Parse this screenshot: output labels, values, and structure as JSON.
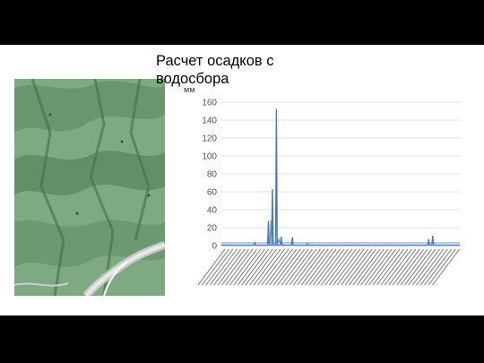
{
  "slide": {
    "title_line1": "Расчет осадков с",
    "title_line2": "водосбора"
  },
  "map": {
    "icon": "topographic-map-image"
  },
  "chart_data": {
    "type": "line",
    "title": "",
    "ylabel": "мм",
    "ylim": [
      0,
      160
    ],
    "yticks": [
      0,
      20,
      40,
      60,
      80,
      100,
      120,
      140,
      160
    ],
    "grid": true,
    "legend": "none",
    "color": "#4a7ab5",
    "points": 300,
    "baseline": 0.5,
    "series": [
      {
        "peaks": [
          {
            "x": 42,
            "y": 3
          },
          {
            "x": 59,
            "y": 27
          },
          {
            "x": 64,
            "y": 63
          },
          {
            "x": 69,
            "y": 152
          },
          {
            "x": 75,
            "y": 10
          },
          {
            "x": 89,
            "y": 9
          },
          {
            "x": 108,
            "y": 2
          },
          {
            "x": 260,
            "y": 7
          },
          {
            "x": 265,
            "y": 11
          }
        ]
      },
      {
        "offset": 2.5,
        "peaks": [
          {
            "x": 62,
            "y": 28
          },
          {
            "x": 72,
            "y": 8
          }
        ]
      }
    ]
  }
}
